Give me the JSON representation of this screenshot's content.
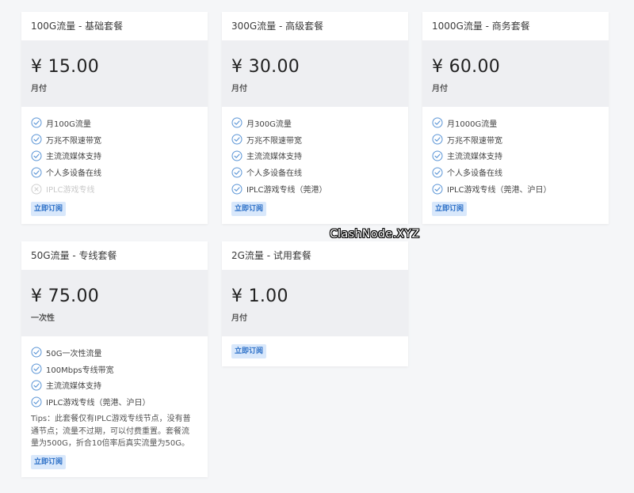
{
  "watermark": "ClashNode.XYZ",
  "button_label": "立即订阅",
  "plans": [
    {
      "title": "100G流量 - 基础套餐",
      "price": "¥ 15.00",
      "period": "月付",
      "features": [
        {
          "text": "月100G流量",
          "icon": "check-circle-icon",
          "enabled": true
        },
        {
          "text": "万兆不限速带宽",
          "icon": "check-circle-icon",
          "enabled": true
        },
        {
          "text": "主流流媒体支持",
          "icon": "check-circle-icon",
          "enabled": true
        },
        {
          "text": "个人多设备在线",
          "icon": "check-circle-icon",
          "enabled": true
        },
        {
          "text": "IPLC游戏专线",
          "icon": "x-circle-icon",
          "enabled": false
        }
      ]
    },
    {
      "title": "300G流量 - 高级套餐",
      "price": "¥ 30.00",
      "period": "月付",
      "features": [
        {
          "text": "月300G流量",
          "icon": "check-circle-icon",
          "enabled": true
        },
        {
          "text": "万兆不限速带宽",
          "icon": "check-circle-icon",
          "enabled": true
        },
        {
          "text": "主流流媒体支持",
          "icon": "check-circle-icon",
          "enabled": true
        },
        {
          "text": "个人多设备在线",
          "icon": "check-circle-icon",
          "enabled": true
        },
        {
          "text": "IPLC游戏专线（莞港）",
          "icon": "check-circle-icon",
          "enabled": true
        }
      ]
    },
    {
      "title": "1000G流量 - 商务套餐",
      "price": "¥ 60.00",
      "period": "月付",
      "features": [
        {
          "text": "月1000G流量",
          "icon": "check-circle-icon",
          "enabled": true
        },
        {
          "text": "万兆不限速带宽",
          "icon": "check-circle-icon",
          "enabled": true
        },
        {
          "text": "主流流媒体支持",
          "icon": "check-circle-icon",
          "enabled": true
        },
        {
          "text": "个人多设备在线",
          "icon": "check-circle-icon",
          "enabled": true
        },
        {
          "text": "IPLC游戏专线（莞港、沪日）",
          "icon": "check-circle-icon",
          "enabled": true
        }
      ]
    },
    {
      "title": "50G流量 - 专线套餐",
      "price": "¥ 75.00",
      "period": "一次性",
      "features": [
        {
          "text": "50G一次性流量",
          "icon": "check-circle-icon",
          "enabled": true
        },
        {
          "text": "100Mbps专线带宽",
          "icon": "check-circle-icon",
          "enabled": true
        },
        {
          "text": "主流流媒体支持",
          "icon": "check-circle-icon",
          "enabled": true
        },
        {
          "text": "IPLC游戏专线（莞港、沪日）",
          "icon": "check-circle-icon",
          "enabled": true
        }
      ],
      "tips_lines": [
        "Tips：此套餐仅有IPLC游戏专线节点，没有普",
        "通节点；流量不过期，可以付费重置。套餐流",
        "量为500G，折合10倍率后真实流量为50G。"
      ]
    },
    {
      "title": "2G流量 - 试用套餐",
      "price": "¥ 1.00",
      "period": "月付",
      "features": []
    }
  ],
  "colors": {
    "page_bg": "#f5f6f8",
    "price_bg": "#eeeff2",
    "accent": "#2b6fc7",
    "button_bg": "#d9e8fb",
    "icon_enabled": "#5b95d6",
    "icon_disabled": "#d0d0d0"
  }
}
